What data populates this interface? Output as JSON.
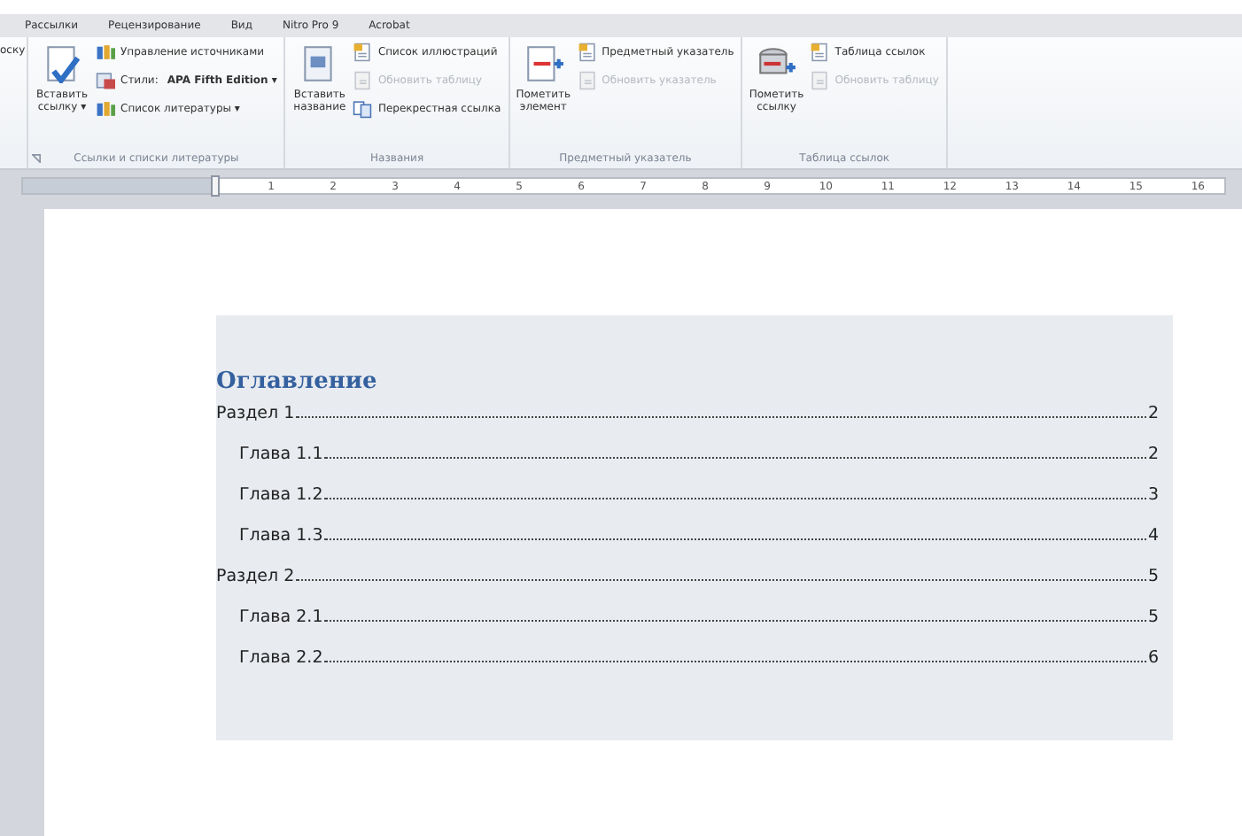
{
  "ribbon_tabs": [
    {
      "label": "Рассылки",
      "selected": false
    },
    {
      "label": "Рецензирование",
      "selected": false
    },
    {
      "label": "Вид",
      "selected": false
    },
    {
      "label": "Nitro Pro 9",
      "selected": false
    },
    {
      "label": "Acrobat",
      "selected": false
    }
  ],
  "ribbon": {
    "cut_label": "оску",
    "groups": [
      {
        "label": "Ссылки и списки литературы",
        "big": {
          "label": "Вставить ссылку ▾"
        },
        "items": [
          {
            "label": "Управление источниками",
            "disabled": false
          },
          {
            "label": "Стили:",
            "value": "APA Fifth Edition ▾",
            "disabled": false
          },
          {
            "label": "Список литературы ▾",
            "disabled": false
          }
        ]
      },
      {
        "label": "Названия",
        "big": {
          "label": "Вставить название"
        },
        "items": [
          {
            "label": "Список иллюстраций",
            "disabled": false
          },
          {
            "label": "Обновить таблицу",
            "disabled": true
          },
          {
            "label": "Перекрестная ссылка",
            "disabled": false
          }
        ]
      },
      {
        "label": "Предметный указатель",
        "big": {
          "label": "Пометить элемент"
        },
        "items": [
          {
            "label": "Предметный указатель",
            "disabled": false
          },
          {
            "label": "Обновить указатель",
            "disabled": true
          }
        ]
      },
      {
        "label": "Таблица ссылок",
        "big": {
          "label": "Пометить ссылку"
        },
        "items": [
          {
            "label": "Таблица ссылок",
            "disabled": false
          },
          {
            "label": "Обновить таблицу",
            "disabled": true
          }
        ]
      }
    ]
  },
  "ruler": {
    "numbers": [
      "1",
      "2",
      "3",
      "4",
      "5",
      "6",
      "7",
      "8",
      "9",
      "10",
      "11",
      "12",
      "13",
      "14",
      "15",
      "16"
    ]
  },
  "toc": {
    "title": "Оглавление",
    "entries": [
      {
        "title": "Раздел 1",
        "page": "2",
        "children": [
          {
            "title": "Глава 1.1",
            "page": "2"
          },
          {
            "title": "Глава 1.2",
            "page": "3"
          },
          {
            "title": "Глава 1.3",
            "page": "4"
          }
        ]
      },
      {
        "title": "Раздел 2",
        "page": "5",
        "children": [
          {
            "title": "Глава 2.1",
            "page": "5"
          },
          {
            "title": "Глава 2.2",
            "page": "6"
          }
        ]
      }
    ]
  }
}
